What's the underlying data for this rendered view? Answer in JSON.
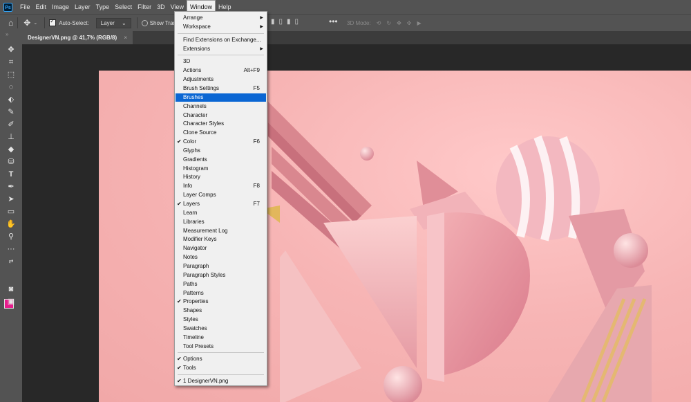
{
  "menubar": {
    "logo": "Ps",
    "items": [
      "File",
      "Edit",
      "Image",
      "Layer",
      "Type",
      "Select",
      "Filter",
      "3D",
      "View",
      "Window",
      "Help"
    ],
    "active": "Window"
  },
  "options": {
    "auto_select_label": "Auto-Select:",
    "auto_select_value": "Layer",
    "show_transform_label": "Show Transform",
    "mode3d_label": "3D Mode:"
  },
  "document": {
    "tab_title": "DesignerVN.png @ 41,7% (RGB/8)",
    "close": "×"
  },
  "colors": {
    "foreground": "#e61c8c",
    "background": "#ffffff",
    "highlight": "#0a66d3"
  },
  "window_menu": {
    "sections": [
      [
        {
          "label": "Arrange",
          "submenu": true
        },
        {
          "label": "Workspace",
          "submenu": true
        }
      ],
      [
        {
          "label": "Find Extensions on Exchange..."
        },
        {
          "label": "Extensions",
          "submenu": true
        }
      ],
      [
        {
          "label": "3D"
        },
        {
          "label": "Actions",
          "shortcut": "Alt+F9"
        },
        {
          "label": "Adjustments"
        },
        {
          "label": "Brush Settings",
          "shortcut": "F5"
        },
        {
          "label": "Brushes",
          "highlighted": true
        },
        {
          "label": "Channels"
        },
        {
          "label": "Character"
        },
        {
          "label": "Character Styles"
        },
        {
          "label": "Clone Source"
        },
        {
          "label": "Color",
          "shortcut": "F6",
          "checked": true
        },
        {
          "label": "Glyphs"
        },
        {
          "label": "Gradients"
        },
        {
          "label": "Histogram"
        },
        {
          "label": "History"
        },
        {
          "label": "Info",
          "shortcut": "F8"
        },
        {
          "label": "Layer Comps"
        },
        {
          "label": "Layers",
          "shortcut": "F7",
          "checked": true
        },
        {
          "label": "Learn"
        },
        {
          "label": "Libraries"
        },
        {
          "label": "Measurement Log"
        },
        {
          "label": "Modifier Keys"
        },
        {
          "label": "Navigator"
        },
        {
          "label": "Notes"
        },
        {
          "label": "Paragraph"
        },
        {
          "label": "Paragraph Styles"
        },
        {
          "label": "Paths"
        },
        {
          "label": "Patterns"
        },
        {
          "label": "Properties",
          "checked": true
        },
        {
          "label": "Shapes"
        },
        {
          "label": "Styles"
        },
        {
          "label": "Swatches"
        },
        {
          "label": "Timeline"
        },
        {
          "label": "Tool Presets"
        }
      ],
      [
        {
          "label": "Options",
          "checked": true
        },
        {
          "label": "Tools",
          "checked": true
        }
      ],
      [
        {
          "label": "1 DesignerVN.png",
          "checked": true
        }
      ]
    ]
  }
}
